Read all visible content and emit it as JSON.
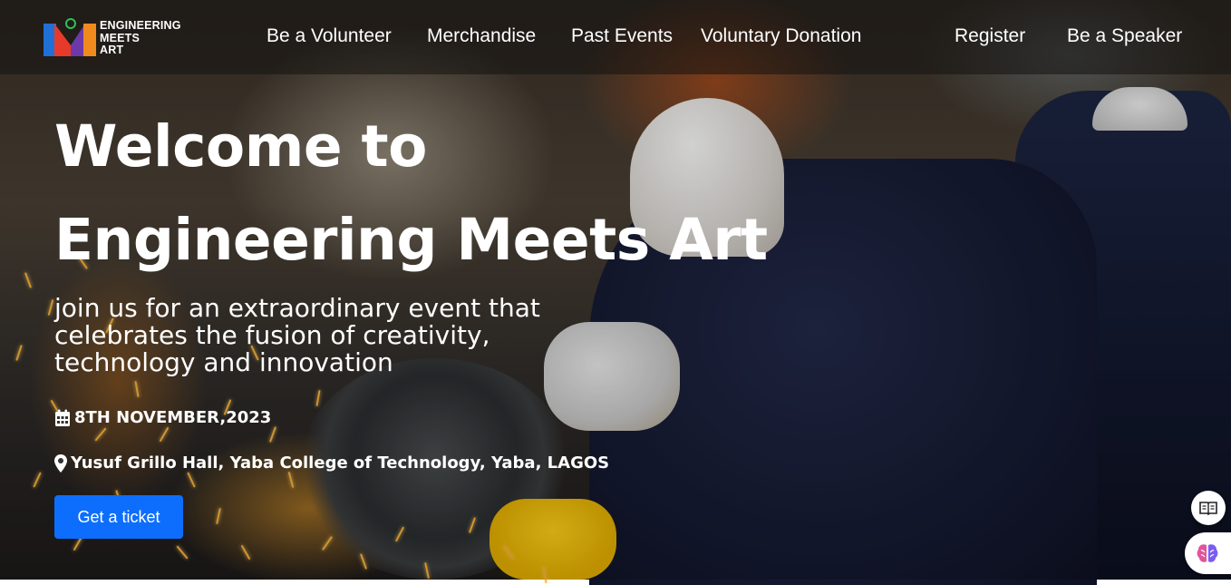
{
  "brand": {
    "logo_lines": [
      "ENGINEERING",
      "MEETS",
      "ART"
    ]
  },
  "nav": {
    "links": [
      "Be a Volunteer",
      "Merchandise",
      "Past Events",
      "Voluntary Donation"
    ],
    "register": "Register",
    "speaker": "Be a Speaker"
  },
  "hero": {
    "title_line1": "Welcome to",
    "title_line2": "Engineering Meets Art",
    "subtitle": "join us for an extraordinary event that celebrates the fusion of creativity, technology and innovation",
    "date": "8TH NOVEMBER,2023",
    "venue": "Yusuf Grillo Hall, Yaba College of Technology, Yaba, LAGOS",
    "cta": "Get a ticket"
  },
  "icons": {
    "date": "calendar-icon",
    "venue": "location-pin-icon",
    "reader": "book-reader-icon",
    "assistant": "brain-icon"
  },
  "colors": {
    "accent": "#0d6efd",
    "nav_bg": "rgba(20,18,16,0.55)"
  }
}
